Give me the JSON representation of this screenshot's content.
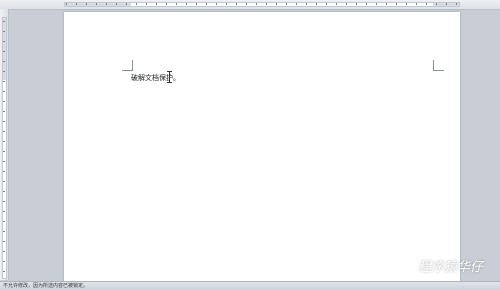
{
  "document": {
    "body_text": "破解文档保护。"
  },
  "status_bar": {
    "text": "不允许修改，因为所选内容已被锁定。"
  },
  "watermark": {
    "label": "程序猿华仔",
    "icon": "wechat-icon"
  }
}
